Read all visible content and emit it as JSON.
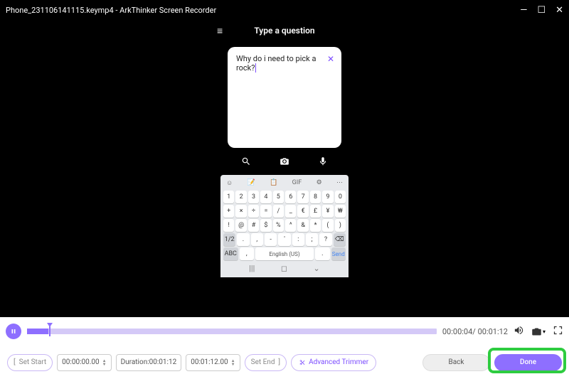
{
  "titlebar": {
    "filename": "Phone_231106141115.keymp4",
    "separator": "  -  ",
    "app": "ArkThinker Screen Recorder"
  },
  "phone": {
    "header": "Type a question",
    "question": "Why do i need to pick a rock?",
    "kb_language": "English (US)",
    "kb_send": "Send",
    "kb_abc": "ABC",
    "kb_half": "1/2",
    "toolbar": [
      "☺",
      "📝",
      "📋",
      "GIF",
      "⚙",
      "⋯"
    ],
    "rows": [
      [
        "1",
        "2",
        "3",
        "4",
        "5",
        "6",
        "7",
        "8",
        "9",
        "0"
      ],
      [
        "+",
        "×",
        "÷",
        "=",
        "/",
        "_",
        "€",
        "£",
        "¥",
        "₩"
      ],
      [
        "!",
        "@",
        "#",
        "$",
        "%",
        "^",
        "&",
        "*",
        "(",
        ")"
      ],
      [
        "1/2",
        ".",
        ",",
        "-",
        "'",
        ":",
        ";",
        "?",
        "⌫"
      ]
    ],
    "nav": [
      "|||",
      "◻",
      "⌄"
    ]
  },
  "timeline": {
    "current": "00:00:04",
    "total": "00:01:12"
  },
  "bottom": {
    "setstart": "Set Start",
    "start_time": "00:00:00.00",
    "duration_label": "Duration:",
    "duration_value": "00:01:12",
    "end_time": "00:01:12.00",
    "setend": "Set End",
    "adv": "Advanced Trimmer",
    "back": "Back",
    "done": "Done"
  }
}
